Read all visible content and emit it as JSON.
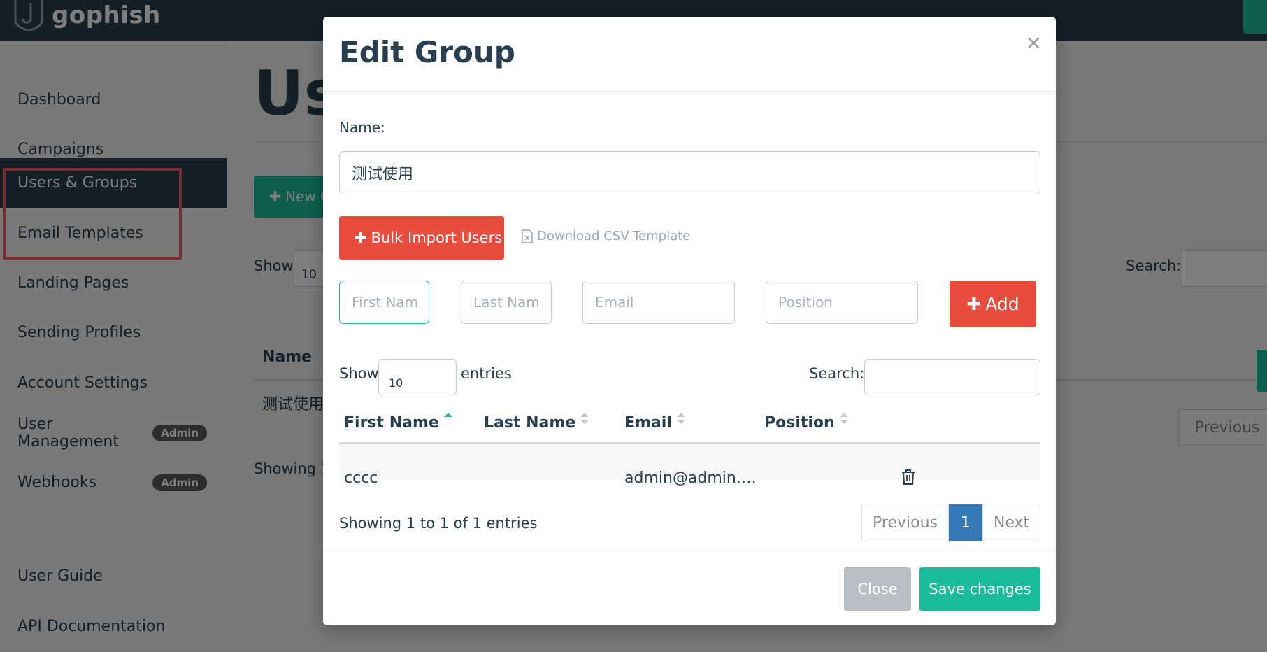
{
  "brand": {
    "name": "gophish",
    "logo": "gophish-shield-logo"
  },
  "sidebar": {
    "items": [
      {
        "label": "Dashboard"
      },
      {
        "label": "Campaigns"
      },
      {
        "label": "Users & Groups"
      },
      {
        "label": "Email Templates"
      },
      {
        "label": "Landing Pages"
      },
      {
        "label": "Sending Profiles"
      },
      {
        "label": "Account Settings"
      },
      {
        "label": "User Management",
        "badge": "Admin"
      },
      {
        "label": "Webhooks",
        "badge": "Admin"
      },
      {
        "label": "User Guide"
      },
      {
        "label": "API Documentation"
      }
    ]
  },
  "main": {
    "title": "Us",
    "new_btn": "New G",
    "show_label": "Show",
    "show_value": "10",
    "col_name": "Name",
    "row_name": "测试使用",
    "showing": "Showing 1",
    "search_label": "Search:",
    "prev": "Previous"
  },
  "modal": {
    "title": "Edit Group",
    "close_x": "×",
    "name_label": "Name:",
    "name_value": "测试使用",
    "bulk_import": "Bulk Import Users",
    "csv_template": "Download CSV Template",
    "placeholders": {
      "first_name": "First Name",
      "last_name": "Last Name",
      "email": "Email",
      "position": "Position"
    },
    "add_btn": "Add",
    "show_label": "Show",
    "show_value": "10",
    "entries_label": "entries",
    "search_label": "Search:",
    "columns": [
      "First Name",
      "Last Name",
      "Email",
      "Position"
    ],
    "rows": [
      {
        "first_name": "cccc",
        "last_name": "",
        "email": "admin@admin.…",
        "position": ""
      }
    ],
    "showing": "Showing 1 to 1 of 1 entries",
    "pager": {
      "prev": "Previous",
      "page": "1",
      "next": "Next"
    },
    "footer": {
      "close": "Close",
      "save": "Save changes"
    }
  },
  "colors": {
    "navbar": "#283f50",
    "accent_green": "#1abc9c",
    "danger_red": "#e74c3c",
    "pager_active": "#337ab7",
    "annotation": "#f25a66"
  }
}
